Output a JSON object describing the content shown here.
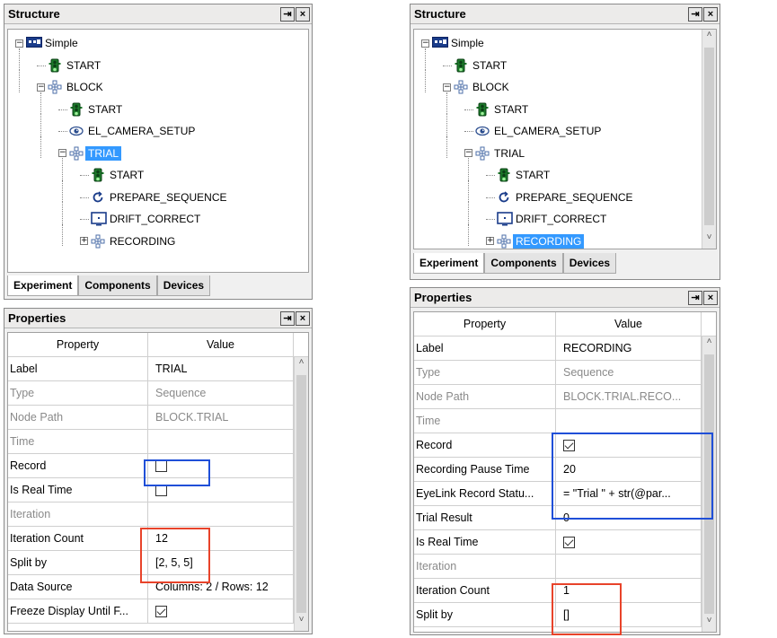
{
  "colors": {
    "selection": "#3399ff",
    "highlight_blue": "#1f4fd8",
    "highlight_red": "#e8432a"
  },
  "left": {
    "structure": {
      "title": "Structure",
      "pin": "⇥",
      "close": "×",
      "nodes": [
        {
          "label": "Simple",
          "icon": "experiment-icon",
          "expander": "−",
          "level": 0
        },
        {
          "label": "START",
          "icon": "start-trafficlight-icon",
          "level": 1
        },
        {
          "label": "BLOCK",
          "icon": "sequence-icon",
          "expander": "−",
          "level": 1
        },
        {
          "label": "START",
          "icon": "start-trafficlight-icon",
          "level": 2
        },
        {
          "label": "EL_CAMERA_SETUP",
          "icon": "camera-setup-eye-icon",
          "level": 2
        },
        {
          "label": "TRIAL",
          "icon": "sequence-icon",
          "expander": "−",
          "level": 2,
          "selected": true
        },
        {
          "label": "START",
          "icon": "start-trafficlight-icon",
          "level": 3
        },
        {
          "label": "PREPARE_SEQUENCE",
          "icon": "prepare-sequence-icon",
          "level": 3
        },
        {
          "label": "DRIFT_CORRECT",
          "icon": "drift-correct-icon",
          "level": 3
        },
        {
          "label": "RECORDING",
          "icon": "sequence-icon",
          "expander": "+",
          "level": 3
        }
      ],
      "tabs": [
        "Experiment",
        "Components",
        "Devices"
      ]
    },
    "properties": {
      "title": "Properties",
      "pin": "⇥",
      "close": "×",
      "header": {
        "property": "Property",
        "value": "Value"
      },
      "rows": [
        {
          "name": "Label",
          "value": "TRIAL",
          "grey": false
        },
        {
          "name": "Type",
          "value": "Sequence",
          "grey": true
        },
        {
          "name": "Node Path",
          "value": "BLOCK.TRIAL",
          "grey": true
        },
        {
          "name": "Time",
          "value": "",
          "grey": true
        },
        {
          "name": "Record",
          "checkbox": false
        },
        {
          "name": "Is Real Time",
          "checkbox": false
        },
        {
          "name": "Iteration",
          "value": "",
          "grey": true
        },
        {
          "name": "Iteration Count",
          "value": "12"
        },
        {
          "name": "Split by",
          "value": "[2, 5, 5]"
        },
        {
          "name": "Data Source",
          "value": "Columns: 2 / Rows: 12"
        },
        {
          "name": "Freeze Display Until F...",
          "checkbox": true
        }
      ]
    }
  },
  "right": {
    "structure": {
      "title": "Structure",
      "pin": "⇥",
      "close": "×",
      "nodes": [
        {
          "label": "Simple",
          "icon": "experiment-icon",
          "expander": "−",
          "level": 0
        },
        {
          "label": "START",
          "icon": "start-trafficlight-icon",
          "level": 1
        },
        {
          "label": "BLOCK",
          "icon": "sequence-icon",
          "expander": "−",
          "level": 1
        },
        {
          "label": "START",
          "icon": "start-trafficlight-icon",
          "level": 2
        },
        {
          "label": "EL_CAMERA_SETUP",
          "icon": "camera-setup-eye-icon",
          "level": 2
        },
        {
          "label": "TRIAL",
          "icon": "sequence-icon",
          "expander": "−",
          "level": 2
        },
        {
          "label": "START",
          "icon": "start-trafficlight-icon",
          "level": 3
        },
        {
          "label": "PREPARE_SEQUENCE",
          "icon": "prepare-sequence-icon",
          "level": 3
        },
        {
          "label": "DRIFT_CORRECT",
          "icon": "drift-correct-icon",
          "level": 3
        },
        {
          "label": "RECORDING",
          "icon": "sequence-icon",
          "expander": "+",
          "level": 3,
          "selected": true
        }
      ],
      "tabs": [
        "Experiment",
        "Components",
        "Devices"
      ]
    },
    "properties": {
      "title": "Properties",
      "pin": "⇥",
      "close": "×",
      "header": {
        "property": "Property",
        "value": "Value"
      },
      "rows": [
        {
          "name": "Label",
          "value": "RECORDING"
        },
        {
          "name": "Type",
          "value": "Sequence",
          "grey": true
        },
        {
          "name": "Node Path",
          "value": "BLOCK.TRIAL.RECO...",
          "grey": true
        },
        {
          "name": "Time",
          "value": "",
          "grey": true
        },
        {
          "name": "Record",
          "checkbox": true
        },
        {
          "name": "Recording Pause Time",
          "value": "20"
        },
        {
          "name": "EyeLink Record Statu...",
          "value": "= \"Trial \" + str(@par..."
        },
        {
          "name": "Trial Result",
          "value": "0"
        },
        {
          "name": "Is Real Time",
          "checkbox": true
        },
        {
          "name": "Iteration",
          "value": "",
          "grey": true
        },
        {
          "name": "Iteration Count",
          "value": "1"
        },
        {
          "name": "Split by",
          "value": "[]"
        }
      ]
    }
  }
}
